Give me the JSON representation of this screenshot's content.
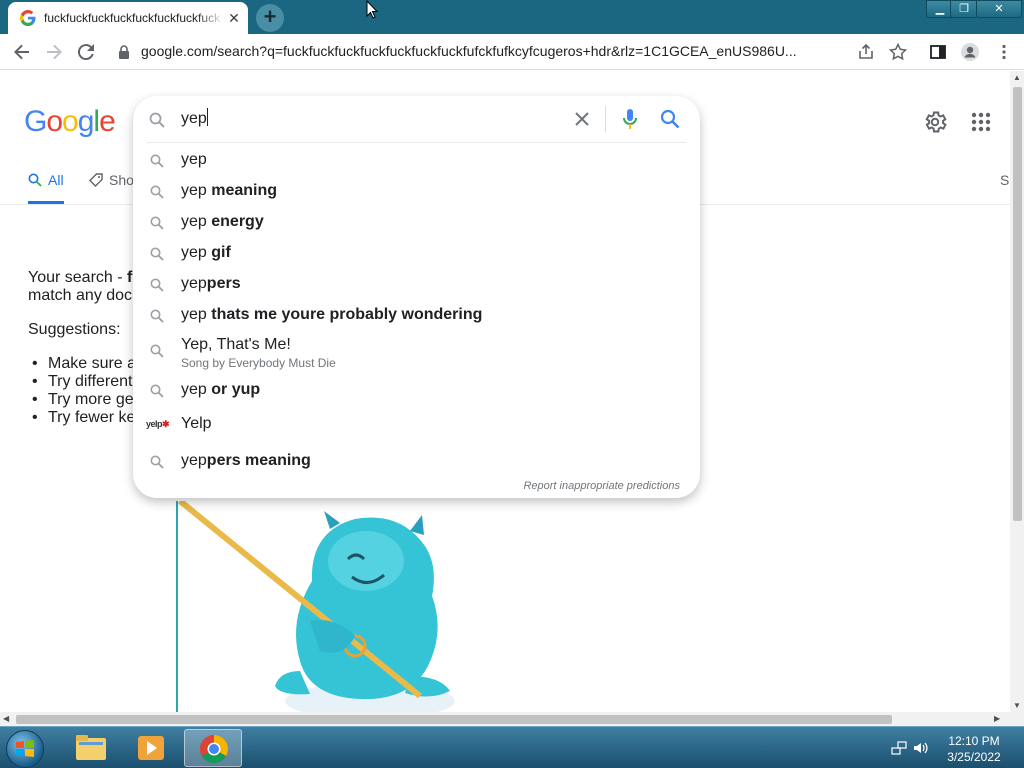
{
  "browser": {
    "tab_title": "fuckfuckfuckfuckfuckfuckfuckfuck",
    "url": "google.com/search?q=fuckfuckfuckfuckfuckfuckfuckfufckfufkcyfcugeros+hdr&rlz=1C1GCEA_enUS986U..."
  },
  "page": {
    "logo": "Google",
    "tabs": [
      {
        "label": "All"
      },
      {
        "label": "Sho"
      }
    ],
    "right_cut_label": "S",
    "no_results_line1_prefix": "Your search - ",
    "no_results_line1_bold": "f",
    "no_results_line2": "match any doc",
    "suggestions_title": "Suggestions:",
    "suggestions": [
      "Make sure a",
      "Try different",
      "Try more ge",
      "Try fewer ke"
    ]
  },
  "search": {
    "query": "yep",
    "report_label": "Report inappropriate predictions",
    "autocomplete": [
      {
        "prefix": "yep",
        "bold": ""
      },
      {
        "prefix": "yep ",
        "bold": "meaning"
      },
      {
        "prefix": "yep ",
        "bold": "energy"
      },
      {
        "prefix": "yep ",
        "bold": "gif"
      },
      {
        "prefix": "yep",
        "bold": "pers"
      },
      {
        "prefix": "yep ",
        "bold": "thats me youre probably wondering"
      },
      {
        "prefix": "Yep, That's Me!",
        "bold": "",
        "subtitle": "Song by Everybody Must Die"
      },
      {
        "prefix": "yep ",
        "bold": "or yup"
      },
      {
        "prefix": "Yelp",
        "bold": "",
        "icon": "yelp-logo"
      },
      {
        "prefix": "yep",
        "bold": "pers meaning"
      }
    ]
  },
  "taskbar": {
    "time": "12:10 PM",
    "date": "3/25/2022"
  },
  "colors": {
    "titlebar": "#1b6680",
    "accent": "#1a73e8"
  }
}
